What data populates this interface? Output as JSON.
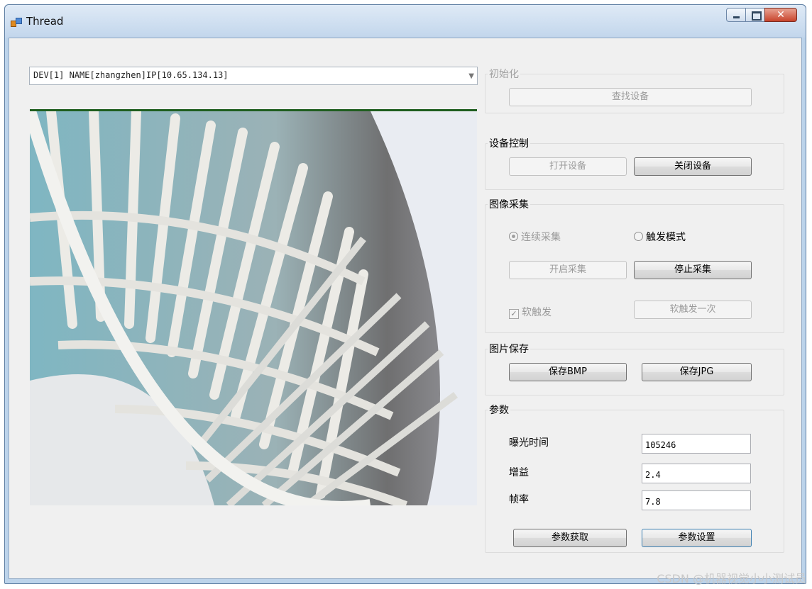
{
  "window": {
    "title": "Thread"
  },
  "device_combo": {
    "value": "DEV[1] NAME[zhangzhen]IP[10.65.134.13]"
  },
  "groups": {
    "init": {
      "title": "初始化",
      "find_button": "查找设备"
    },
    "device_control": {
      "title": "设备控制",
      "open_button": "打开设备",
      "close_button": "关闭设备"
    },
    "acquisition": {
      "title": "图像采集",
      "continuous_label": "连续采集",
      "trigger_label": "触发模式",
      "start_button": "开启采集",
      "stop_button": "停止采集",
      "soft_trigger_label": "软触发",
      "soft_trigger_once_button": "软触发一次"
    },
    "save": {
      "title": "图片保存",
      "save_bmp_button": "保存BMP",
      "save_jpg_button": "保存JPG"
    },
    "params": {
      "title": "参数",
      "exposure_label": "曝光时间",
      "exposure_value": "105246",
      "gain_label": "增益",
      "gain_value": "2.4",
      "framerate_label": "帧率",
      "framerate_value": "7.8",
      "get_button": "参数获取",
      "set_button": "参数设置"
    }
  },
  "watermark": "CSDN @机器视觉小小测试员",
  "colors": {
    "titlebar": "#c2d6ec",
    "client_bg": "#f0f0f0",
    "close_button": "#c8442c"
  }
}
